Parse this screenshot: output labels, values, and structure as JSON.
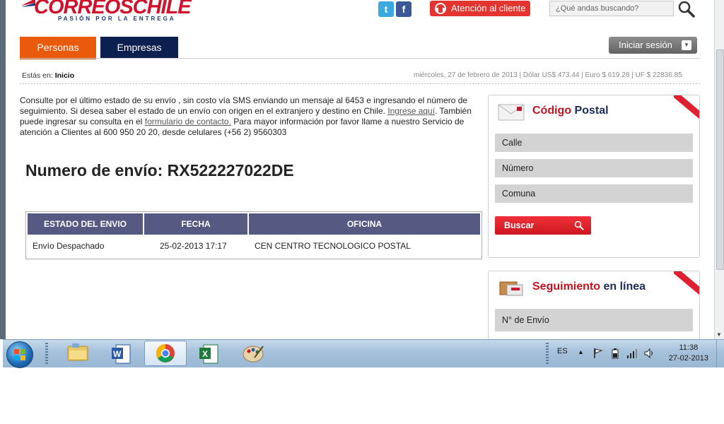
{
  "header": {
    "logo_text": "CORREOSCHILE",
    "logo_tagline": "PASIÓN POR LA ENTREGA",
    "social": [
      "twitter-icon",
      "facebook-icon"
    ],
    "attention_button": "Atención al cliente",
    "search_placeholder": "¿Qué andas buscando?",
    "tabs": [
      {
        "label": "Personas"
      },
      {
        "label": "Empresas"
      }
    ],
    "login_button": "Iniciar sesión"
  },
  "breadcrumb": {
    "prefix": "Estás en:",
    "current": "Inicio"
  },
  "ticker": "miércoles, 27 de febrero de 2013 | Dólar US$ 473.44 | Euro $ 619.28 | UF $ 22836.85",
  "info": {
    "p1": "Consulte por el último estado de su envío , sin costo vía SMS enviando un mensaje al 6453 e ingresando el número de seguimiento. Si desea saber el estado de un envío con origen en el extranjero y destino en Chile.",
    "link1": "Ingrese aquí",
    "p2": "También puede ingresar su consulta en el",
    "link2": "formulario de contacto.",
    "p3": "Para mayor información por favor llame a nuestro Servicio de atención a Clientes al 600 950 20 20, desde celulares (+56 2) 9560303"
  },
  "tracking": {
    "title": "Numero de envío: RX522227022DE",
    "columns": [
      "ESTADO DEL ENVIO",
      "FECHA",
      "OFICINA"
    ],
    "rows": [
      [
        "Envío Despachado",
        "25-02-2013 17:17",
        "CEN CENTRO TECNOLOGICO POSTAL"
      ]
    ]
  },
  "postal_code": {
    "title_red": "Código",
    "title_blue": "Postal",
    "fields": [
      "Calle",
      "Número",
      "Comuna"
    ],
    "button": "Buscar"
  },
  "online_tracking": {
    "title_red": "Seguimiento",
    "title_blue": "en línea",
    "field": "N° de Envío"
  },
  "taskbar": {
    "apps": [
      "explorer-icon",
      "word-icon",
      "chrome-icon",
      "excel-icon",
      "paint-icon"
    ],
    "language": "ES",
    "time": "11:38",
    "date": "27-02-2013"
  },
  "colors": {
    "brand_red": "#d0112b",
    "tab_orange": "#e95a0c",
    "tab_navy": "#0d1f4e",
    "table_header": "#565a82"
  }
}
